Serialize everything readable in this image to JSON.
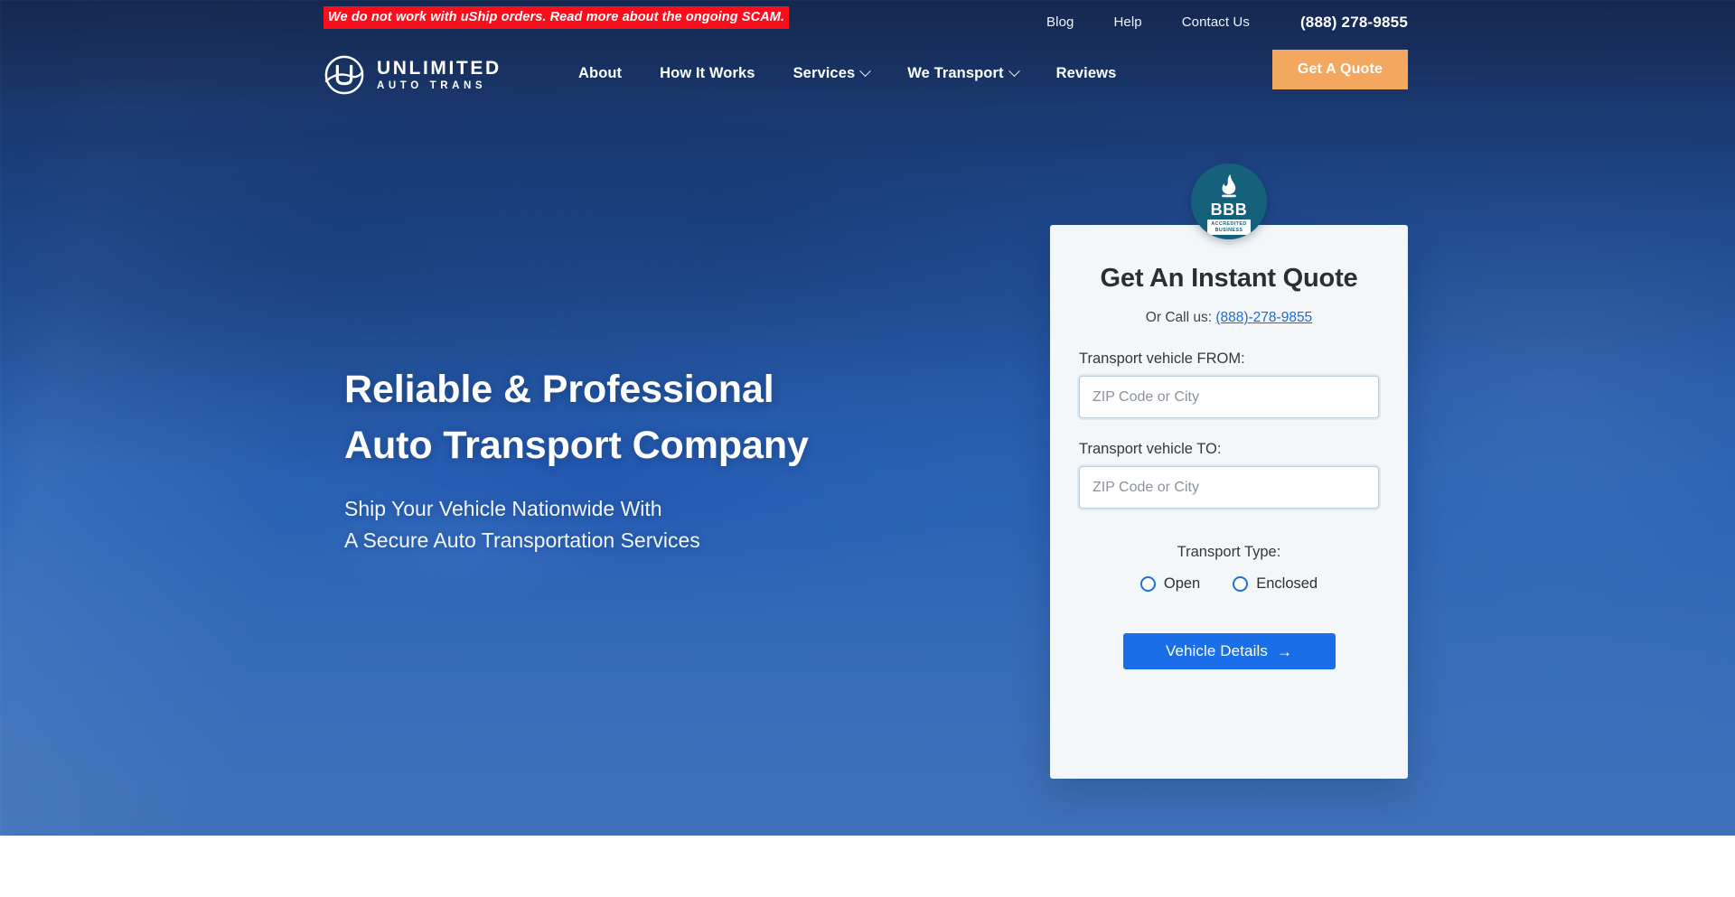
{
  "announcement": {
    "text": "We do not work with uShip orders. Read more about the ongoing SCAM.",
    "background_color": "#fc0d1b",
    "text_color": "#ffffff"
  },
  "utility_nav": {
    "links": [
      {
        "label": "Blog"
      },
      {
        "label": "Help"
      },
      {
        "label": "Contact Us"
      }
    ],
    "phone": "(888) 278-9855"
  },
  "brand": {
    "name_top": "UNLIMITED",
    "name_bottom": "AUTO TRANS",
    "logo_icon": "unlimited-auto-trans-monogram-icon"
  },
  "main_nav": {
    "items": [
      {
        "label": "About",
        "has_dropdown": false
      },
      {
        "label": "How It Works",
        "has_dropdown": false
      },
      {
        "label": "Services",
        "has_dropdown": true
      },
      {
        "label": "We Transport",
        "has_dropdown": true
      },
      {
        "label": "Reviews",
        "has_dropdown": false
      }
    ],
    "cta_label": "Get A Quote",
    "cta_color": "#f4a75e"
  },
  "hero": {
    "title_line1": "Reliable & Professional",
    "title_line2": "Auto Transport Company",
    "subtitle_line1": "Ship Your Vehicle Nationwide With",
    "subtitle_line2": "A Secure Auto Transportation Services",
    "background_tint": "#2f66b0"
  },
  "quote_form": {
    "badge": {
      "letters": "BBB",
      "accredited_line1": "ACCREDITED",
      "accredited_line2": "BUSINESS",
      "icon": "bbb-torch-flame-icon",
      "color": "#15607a"
    },
    "title": "Get An Instant Quote",
    "call_prefix": "Or Call us:",
    "call_number": "(888)-278-9855",
    "from_label": "Transport vehicle FROM:",
    "from_placeholder": "ZIP Code or City",
    "from_value": "",
    "to_label": "Transport vehicle TO:",
    "to_placeholder": "ZIP Code or City",
    "to_value": "",
    "transport_type_label": "Transport Type:",
    "transport_options": [
      {
        "label": "Open",
        "selected": false
      },
      {
        "label": "Enclosed",
        "selected": false
      }
    ],
    "submit_label": "Vehicle Details",
    "submit_arrow": "→",
    "submit_color": "#1a6ee8"
  }
}
